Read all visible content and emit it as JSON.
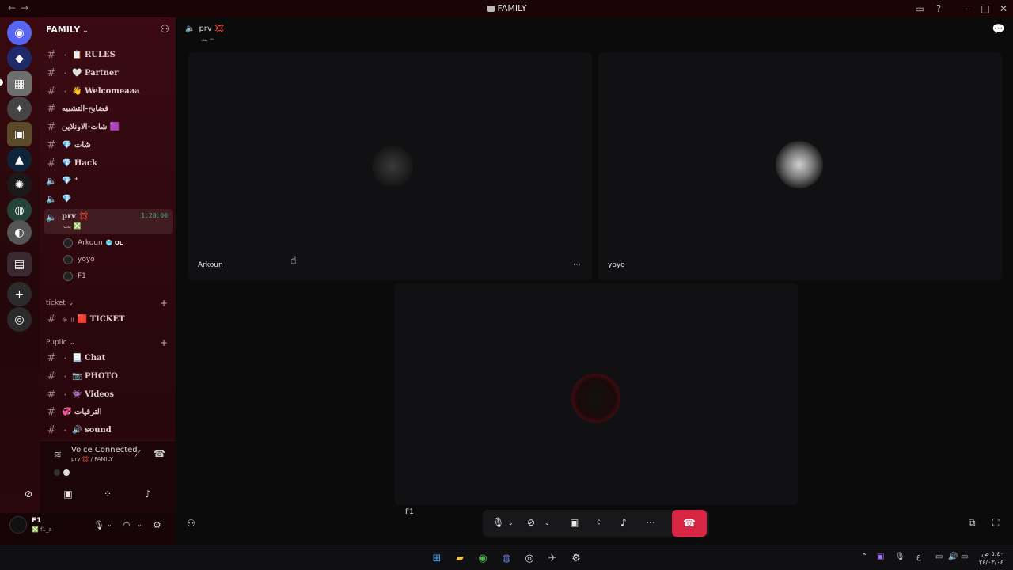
{
  "window": {
    "title": "FAMILY",
    "nav_back": "←",
    "nav_forward": "→"
  },
  "guild": {
    "name": "FAMILY"
  },
  "channels": [
    {
      "type": "text",
      "bullet": "・",
      "label": "📋 RULES"
    },
    {
      "type": "text",
      "bullet": "・",
      "label": "🤍 Partner"
    },
    {
      "type": "text",
      "bullet": "・",
      "label": "👋 Welcomeaaa"
    },
    {
      "type": "text",
      "bullet": "",
      "label": "فضايح-التشبيه"
    },
    {
      "type": "text",
      "bullet": "",
      "label": "شات-الاونلاين 🟪"
    },
    {
      "type": "text",
      "bullet": "",
      "label": "💎 شات"
    },
    {
      "type": "text",
      "bullet": "",
      "label": "💎 Hack"
    },
    {
      "type": "voice",
      "bullet": "",
      "label": "💎 ⁺"
    },
    {
      "type": "voice",
      "bullet": "",
      "label": "💎"
    }
  ],
  "active_voice": {
    "label": "prv 💢",
    "timer": "1:28:00",
    "status": "بث ❎"
  },
  "voice_members": [
    {
      "name": "Arkoun",
      "badge": "🥶 OL"
    },
    {
      "name": "yoyo",
      "badge": ""
    },
    {
      "name": "F1",
      "badge": ""
    }
  ],
  "categories": [
    {
      "name": "ticket",
      "channels": [
        {
          "bullet": "※ ॥",
          "label": "🟥 TICKET"
        }
      ]
    },
    {
      "name": "Puplic",
      "channels": [
        {
          "bullet": "・",
          "label": "📃 Chat"
        },
        {
          "bullet": "・",
          "label": "📷 PHOTO"
        },
        {
          "bullet": "・",
          "label": "👾 Videos"
        },
        {
          "bullet": "",
          "label": "💞 الترقيات"
        },
        {
          "bullet": "・",
          "label": "🔊 sound"
        }
      ]
    }
  ],
  "voice_panel": {
    "title": "Voice Connected",
    "subtitle": "prv 💢 / FAMILY"
  },
  "user": {
    "name": "F1",
    "status": "❎ f1_a"
  },
  "main": {
    "channel": "prv 💢",
    "topic": "بث ✏"
  },
  "tiles": [
    {
      "name": "Arkoun"
    },
    {
      "name": "yoyo"
    },
    {
      "name": "F1"
    }
  ],
  "colors": {
    "accent": "#d92644",
    "sidebar": "#3b0a12",
    "speaking": "#43b581"
  }
}
